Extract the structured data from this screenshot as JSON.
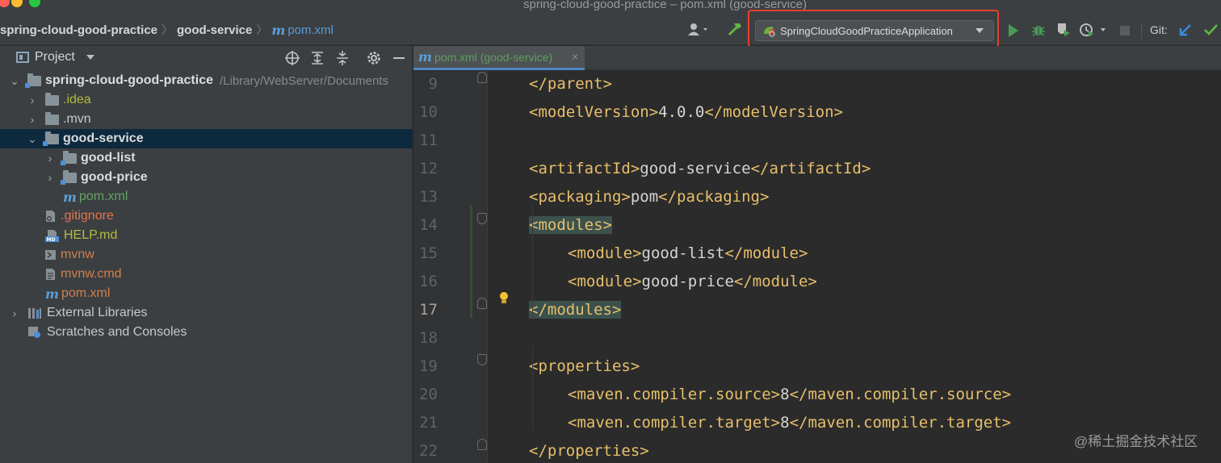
{
  "window": {
    "title": "spring-cloud-good-practice – pom.xml (good-service)"
  },
  "breadcrumbs": {
    "items": [
      "spring-cloud-good-practice",
      "good-service",
      "pom.xml"
    ],
    "file_icon": "m"
  },
  "toolbar": {
    "run_config": "SpringCloudGoodPracticeApplication",
    "git_label": "Git:",
    "highlight_color": "#e5402c"
  },
  "project_panel": {
    "title": "Project",
    "tree": [
      {
        "name": "spring-cloud-good-practice",
        "path": "/Library/WebServer/Documents",
        "depth": 0,
        "expanded": true,
        "kind": "project"
      },
      {
        "name": ".idea",
        "depth": 1,
        "expanded": false,
        "kind": "folder"
      },
      {
        "name": ".mvn",
        "depth": 1,
        "expanded": false,
        "kind": "folder"
      },
      {
        "name": "good-service",
        "depth": 1,
        "expanded": true,
        "kind": "module",
        "selected": true
      },
      {
        "name": "good-list",
        "depth": 2,
        "expanded": false,
        "kind": "module"
      },
      {
        "name": "good-price",
        "depth": 2,
        "expanded": false,
        "kind": "module"
      },
      {
        "name": "pom.xml",
        "depth": 2,
        "kind": "pom"
      },
      {
        "name": ".gitignore",
        "depth": 1,
        "kind": "gitignore"
      },
      {
        "name": "HELP.md",
        "depth": 1,
        "kind": "markdown"
      },
      {
        "name": "mvnw",
        "depth": 1,
        "kind": "script"
      },
      {
        "name": "mvnw.cmd",
        "depth": 1,
        "kind": "cmd"
      },
      {
        "name": "pom.xml",
        "depth": 1,
        "kind": "pom"
      },
      {
        "name": "External Libraries",
        "depth": 0,
        "expanded": false,
        "kind": "libraries"
      },
      {
        "name": "Scratches and Consoles",
        "depth": 0,
        "kind": "scratches"
      }
    ]
  },
  "editor": {
    "tab_label": "pom.xml (good-service)",
    "current_line": 17,
    "lines": [
      {
        "no": "9",
        "indent": 1,
        "tag_open": "</parent>",
        "text": "",
        "tag_close": ""
      },
      {
        "no": "10",
        "indent": 1,
        "tag_open": "<modelVersion>",
        "text": "4.0.0",
        "tag_close": "</modelVersion>"
      },
      {
        "no": "11",
        "indent": 1,
        "tag_open": "",
        "text": "",
        "tag_close": ""
      },
      {
        "no": "12",
        "indent": 1,
        "tag_open": "<artifactId>",
        "text": "good-service",
        "tag_close": "</artifactId>"
      },
      {
        "no": "13",
        "indent": 1,
        "tag_open": "<packaging>",
        "text": "pom",
        "tag_close": "</packaging>"
      },
      {
        "no": "14",
        "indent": 1,
        "tag_open": "<modules>",
        "text": "",
        "tag_close": ""
      },
      {
        "no": "15",
        "indent": 2,
        "tag_open": "<module>",
        "text": "good-list",
        "tag_close": "</module>"
      },
      {
        "no": "16",
        "indent": 2,
        "tag_open": "<module>",
        "text": "good-price",
        "tag_close": "</module>"
      },
      {
        "no": "17",
        "indent": 1,
        "tag_open": "</modules>",
        "text": "",
        "tag_close": ""
      },
      {
        "no": "18",
        "indent": 1,
        "tag_open": "",
        "text": "",
        "tag_close": ""
      },
      {
        "no": "19",
        "indent": 1,
        "tag_open": "<properties>",
        "text": "",
        "tag_close": ""
      },
      {
        "no": "20",
        "indent": 2,
        "tag_open": "<maven.compiler.source>",
        "text": "8",
        "tag_close": "</maven.compiler.source>"
      },
      {
        "no": "21",
        "indent": 2,
        "tag_open": "<maven.compiler.target>",
        "text": "8",
        "tag_close": "</maven.compiler.target>"
      },
      {
        "no": "22",
        "indent": 1,
        "tag_open": "</properties>",
        "text": "",
        "tag_close": ""
      }
    ]
  },
  "watermark": "@稀土掘金技术社区",
  "colors": {
    "tag": "#e8bf6a",
    "text": "#d5d5d5",
    "selection": "#0d293e",
    "accent": "#4a88c7"
  }
}
